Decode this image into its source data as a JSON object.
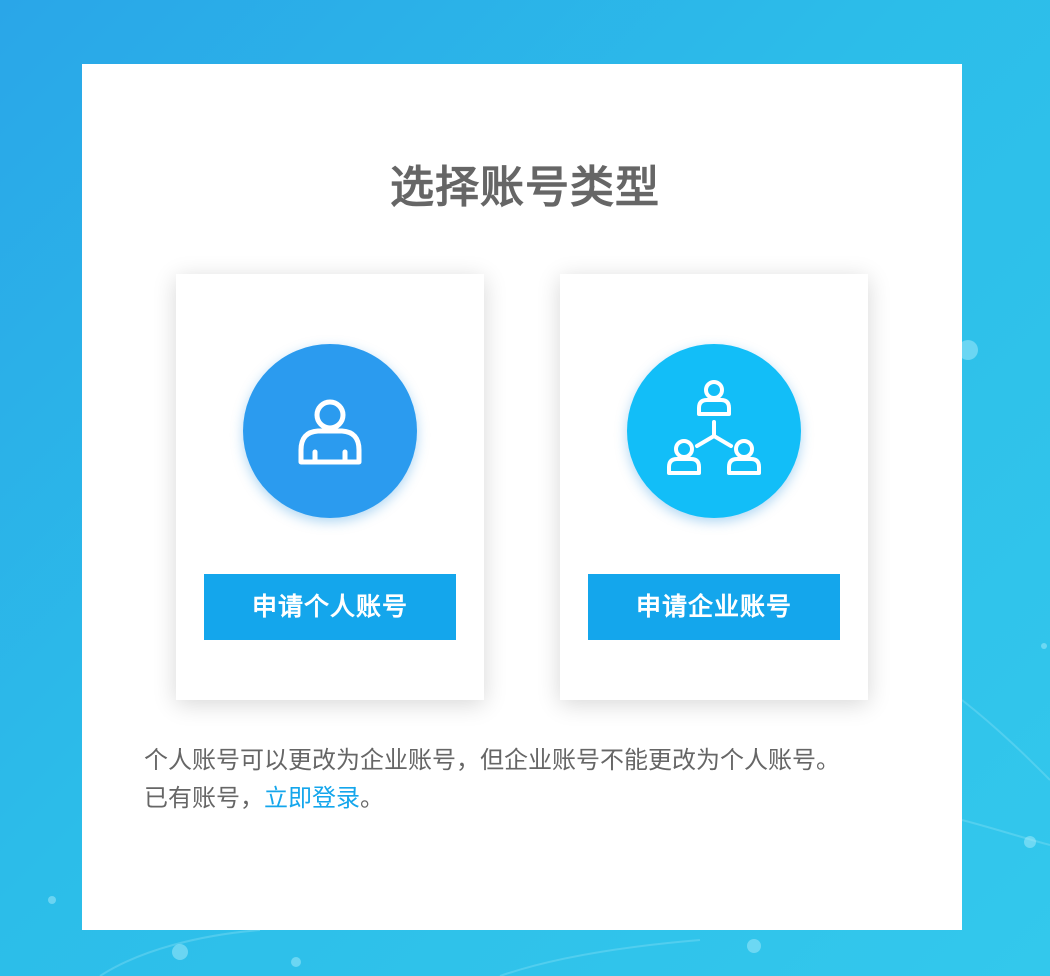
{
  "page": {
    "title": "选择账号类型"
  },
  "cards": {
    "personal": {
      "icon": "user-icon",
      "button_label": "申请个人账号",
      "circle_color": "#2b9bef"
    },
    "enterprise": {
      "icon": "organization-icon",
      "button_label": "申请企业账号",
      "circle_color": "#12bef8"
    }
  },
  "note": {
    "line1": "个人账号可以更改为企业账号，但企业账号不能更改为个人账号。",
    "line2_prefix": "已有账号，",
    "login_link": "立即登录",
    "line2_suffix": "。"
  },
  "colors": {
    "accent": "#14a6ec",
    "background": "#2cbde9",
    "text": "#666666"
  }
}
